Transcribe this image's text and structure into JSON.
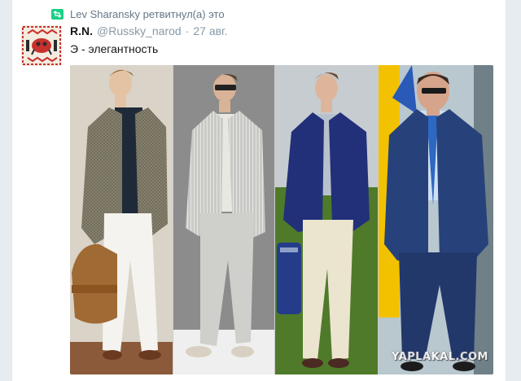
{
  "retweet": {
    "text": "Lev Sharansky ретвитнул(а) это",
    "icon": "retweet-icon"
  },
  "tweet": {
    "author_name": "R.N.",
    "handle": "@Russky_narod",
    "separator": "·",
    "date": "27 авг.",
    "text": "Э - элегантность"
  },
  "media": {
    "watermark": "YAPLAKAL.COM"
  },
  "colors": {
    "retweet_green": "#19cf86",
    "meta_gray": "#8899a6",
    "text_dark": "#14171a",
    "avatar_red": "#c8312c"
  }
}
